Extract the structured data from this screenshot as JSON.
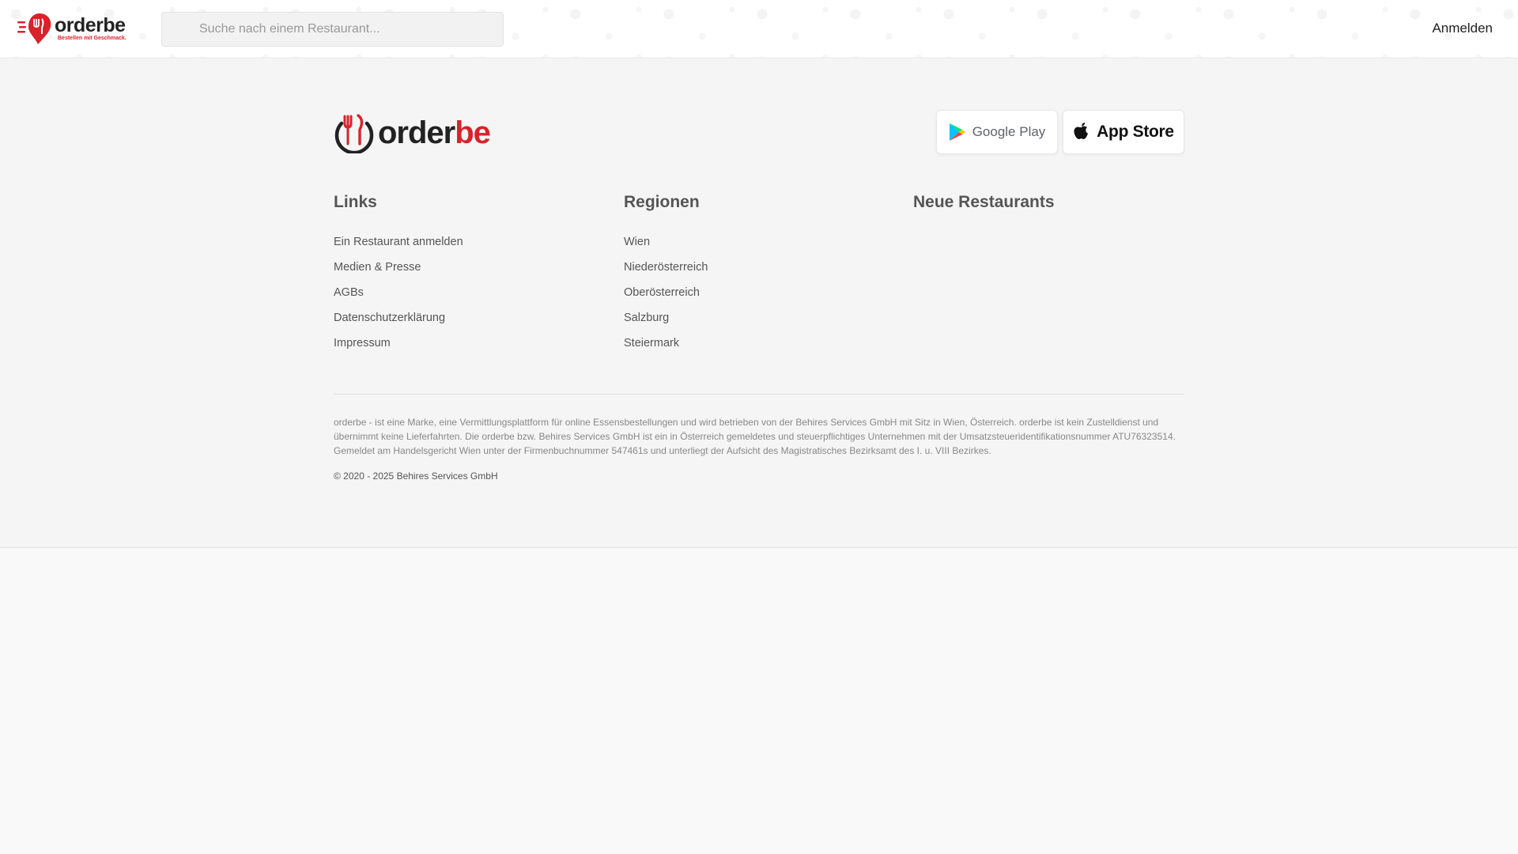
{
  "header": {
    "logo_text": "orderbe",
    "logo_tagline": "Bestellen mit Geschmack.",
    "search_placeholder": "Suche nach einem Restaurant...",
    "login_label": "Anmelden"
  },
  "footer": {
    "logo": {
      "part1": "order",
      "part2": "be"
    },
    "stores": {
      "google_label": "Google Play",
      "apple_label": "App Store"
    },
    "columns": {
      "links": {
        "title": "Links",
        "items": [
          "Ein Restaurant anmelden",
          "Medien & Presse",
          "AGBs",
          "Datenschutzerklärung",
          "Impressum"
        ]
      },
      "regions": {
        "title": "Regionen",
        "items": [
          "Wien",
          "Niederösterreich",
          "Oberösterreich",
          "Salzburg",
          "Steiermark"
        ]
      },
      "new_restaurants": {
        "title": "Neue Restaurants",
        "items": []
      }
    },
    "legal_text": "orderbe - ist eine Marke, eine Vermittlungsplattform für online Essensbestellungen und wird betrieben von der Behires Services GmbH mit Sitz in Wien, Österreich. orderbe ist kein Zustelldienst und übernimmt keine Lieferfahrten. Die orderbe bzw. Behires Services GmbH ist ein in Österreich gemeldetes und steuerpflichtiges Unternehmen mit der Umsatzsteueridentifikationsnummer ATU76323514. Gemeldet am Handelsgericht Wien unter der Firmenbuchnummer 547461s und unterliegt der Aufsicht des Magistratisches Bezirksamt des I. u. VIII Bezirkes.",
    "copyright": "© 2020 - 2025 Behires Services GmbH"
  },
  "colors": {
    "brand_red": "#d9222a",
    "brand_dark": "#222222",
    "text_gray": "#555555",
    "page_bg": "#f9f9f9"
  }
}
